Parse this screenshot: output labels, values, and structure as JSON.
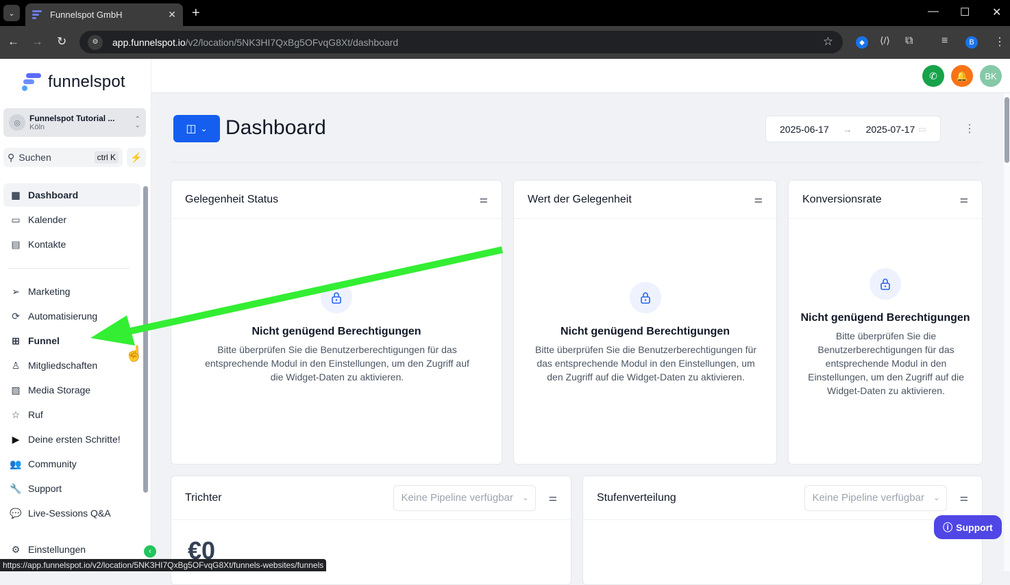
{
  "browser": {
    "tab_title": "Funnelspot GmbH",
    "url_host": "app.funnelspot.io",
    "url_path": "/v2/location/5NK3HI7QxBg5OFvqG8Xt/dashboard",
    "status_url": "https://app.funnelspot.io/v2/location/5NK3HI7QxBg5OFvqG8Xt/funnels-websites/funnels",
    "profile_initial": "B"
  },
  "sidebar": {
    "logo_text": "funnelspot",
    "location_name": "Funnelspot Tutorial ...",
    "location_city": "Köln",
    "search_placeholder": "Suchen",
    "search_shortcut": "ctrl K",
    "items": [
      {
        "label": "Dashboard",
        "icon": "dashboard-icon"
      },
      {
        "label": "Kalender",
        "icon": "calendar-icon"
      },
      {
        "label": "Kontakte",
        "icon": "contacts-icon"
      },
      {
        "label": "Marketing",
        "icon": "send-icon"
      },
      {
        "label": "Automatisierung",
        "icon": "automation-icon"
      },
      {
        "label": "Funnel",
        "icon": "funnel-icon"
      },
      {
        "label": "Mitgliedschaften",
        "icon": "badge-icon"
      },
      {
        "label": "Media Storage",
        "icon": "image-icon"
      },
      {
        "label": "Ruf",
        "icon": "star-icon"
      },
      {
        "label": "Deine ersten Schritte!",
        "icon": "play-icon"
      },
      {
        "label": "Community",
        "icon": "users-icon"
      },
      {
        "label": "Support",
        "icon": "wrench-icon"
      },
      {
        "label": "Live-Sessions Q&A",
        "icon": "chat-icon"
      },
      {
        "label": "Einstellungen",
        "icon": "gear-icon"
      }
    ]
  },
  "topbar": {
    "avatar_initials": "BK",
    "colors": {
      "phone": "#16a34a",
      "bell": "#f97316",
      "avatar": "#86c9a7"
    }
  },
  "dashboard": {
    "title": "Dashboard",
    "date_from": "2025-06-17",
    "date_to": "2025-07-17",
    "cards": [
      {
        "title": "Gelegenheit Status",
        "message_title": "Nicht genügend Berechtigungen",
        "message_body": "Bitte überprüfen Sie die Benutzerberechtigungen für das entsprechende Modul in den Einstellungen, um den Zugriff auf die Widget-Daten zu aktivieren."
      },
      {
        "title": "Wert der Gelegenheit",
        "message_title": "Nicht genügend Berechtigungen",
        "message_body": "Bitte überprüfen Sie die Benutzerberechtigungen für das entsprechende Modul in den Einstellungen, um den Zugriff auf die Widget-Daten zu aktivieren."
      },
      {
        "title": "Konversionsrate",
        "message_title": "Nicht genügend Berechtigungen",
        "message_body": "Bitte überprüfen Sie die Benutzerberechtigungen für das entsprechende Modul in den Einstellungen, um den Zugriff auf die Widget-Daten zu aktivieren."
      }
    ],
    "trichter": {
      "title": "Trichter",
      "pipeline_placeholder": "Keine Pipeline verfügbar",
      "value": "€0"
    },
    "stufen": {
      "title": "Stufenverteilung",
      "pipeline_placeholder": "Keine Pipeline verfügbar"
    },
    "support_button": "Support"
  },
  "annotation": {
    "arrow_color": "#33ee33"
  }
}
